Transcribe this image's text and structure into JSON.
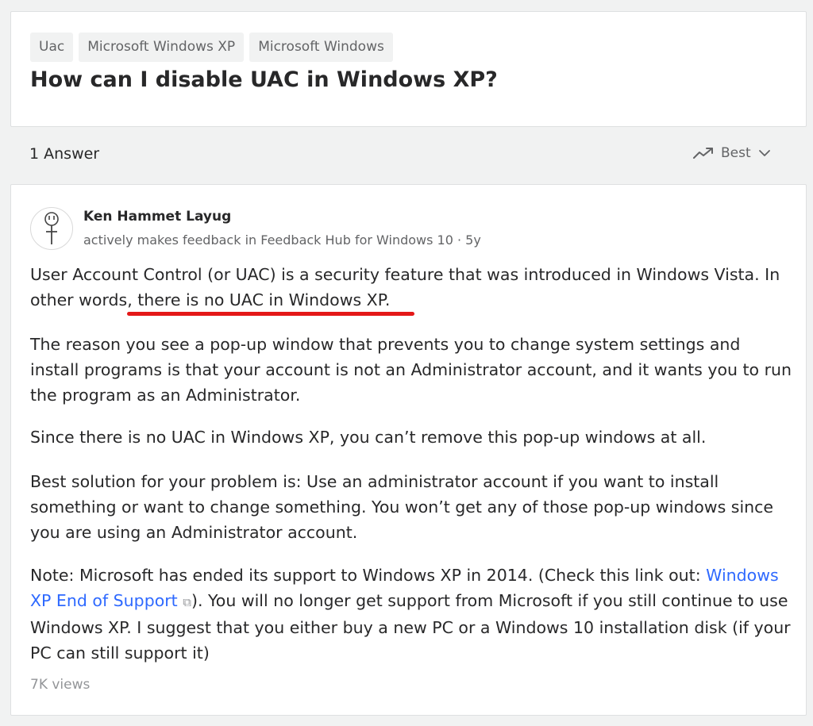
{
  "question": {
    "tags": [
      "Uac",
      "Microsoft Windows XP",
      "Microsoft Windows"
    ],
    "title": "How can I disable UAC in Windows XP?"
  },
  "answers_header": {
    "count_label": "1 Answer",
    "sort_label": "Best",
    "sort_icon": "trending-up-icon",
    "dropdown_icon": "chevron-down-icon"
  },
  "answer": {
    "author": {
      "name": "Ken Hammet Layug",
      "credential": "actively makes feedback in Feedback Hub for Windows 10",
      "separator": " · ",
      "time": "5y"
    },
    "p1": {
      "text_before": "User Account Control (or UAC) is a security feature that was introduced in Windows Vista. In other words, ",
      "highlighted": "there is no UAC in Windows XP.",
      "highlight_color": "#e41818"
    },
    "p2": "The reason you see a pop-up window that prevents you to change system settings and install programs is that your account is not an Administrator account, and it wants you to run the program as an Administrator.",
    "p3": "Since there is no UAC in Windows XP, you can’t remove this pop-up windows at all.",
    "p4": "Best solution for your problem is: Use an administrator account if you want to install something or want to change something. You won’t get any of those pop-up windows since you are using an Administrator account.",
    "p5": {
      "text_before": "Note: Microsoft has ended its support to Windows XP in 2014. (Check this link out: ",
      "link_text": "Windows XP End of Support",
      "link_icon": "external-link-icon",
      "link_icon_glyph": "⧉",
      "text_after": "). You will no longer get support from Microsoft if you still continue to use Windows XP. I suggest that you either buy a new PC or a Windows 10 installation disk (if your PC can still support it)"
    },
    "views": "7K views"
  },
  "colors": {
    "link": "#2e69ff",
    "page_background": "#f1f2f2",
    "card_background": "#ffffff",
    "annotation_underline": "#e41818"
  }
}
